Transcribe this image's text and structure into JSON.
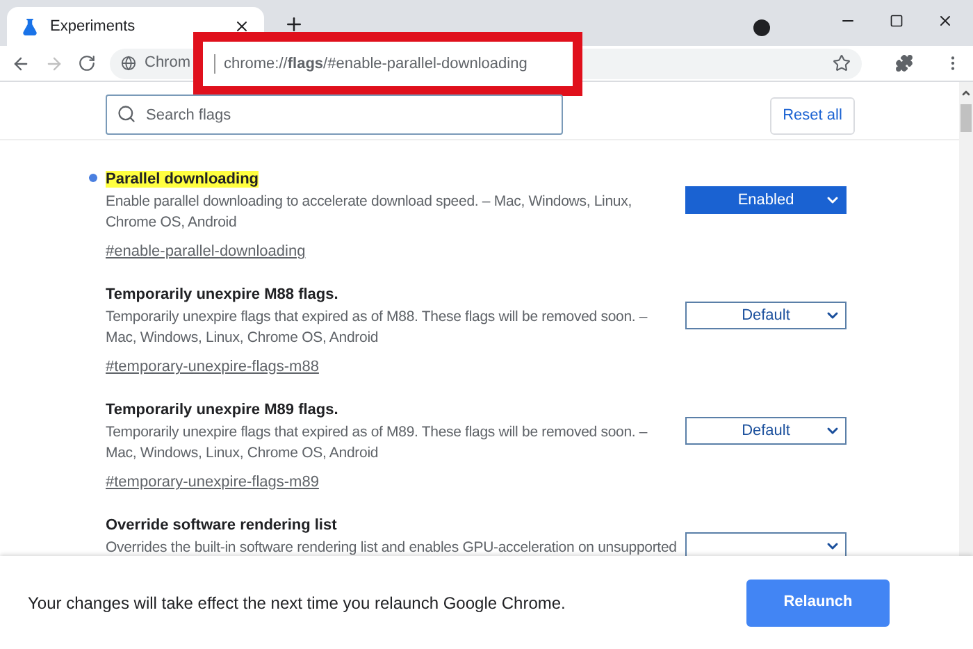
{
  "tab": {
    "title": "Experiments",
    "selected": true
  },
  "omnibox": {
    "site_label": "Chrom",
    "url": "chrome://**flags**/#enable-parallel-downloading"
  },
  "search": {
    "placeholder": "Search flags"
  },
  "reset_button": "Reset all",
  "flags": [
    {
      "title": "Parallel downloading",
      "modified": true,
      "highlighted": true,
      "description": "Enable parallel downloading to accelerate download speed. – Mac, Windows, Linux, Chrome OS, Android",
      "link": "#enable-parallel-downloading",
      "value": "Enabled",
      "active": true
    },
    {
      "title": "Temporarily unexpire M88 flags.",
      "modified": false,
      "highlighted": false,
      "description": "Temporarily unexpire flags that expired as of M88. These flags will be removed soon. – Mac, Windows, Linux, Chrome OS, Android",
      "link": "#temporary-unexpire-flags-m88",
      "value": "Default",
      "active": false
    },
    {
      "title": "Temporarily unexpire M89 flags.",
      "modified": false,
      "highlighted": false,
      "description": "Temporarily unexpire flags that expired as of M89. These flags will be removed soon. – Mac, Windows, Linux, Chrome OS, Android",
      "link": "#temporary-unexpire-flags-m89",
      "value": "Default",
      "active": false
    },
    {
      "title": "Override software rendering list",
      "modified": false,
      "highlighted": false,
      "description": "Overrides the built-in software rendering list and enables GPU-acceleration on unsupported",
      "active": false
    }
  ],
  "footer": {
    "message": "Your changes will take effect the next time you relaunch Google Chrome.",
    "button": "Relaunch"
  }
}
